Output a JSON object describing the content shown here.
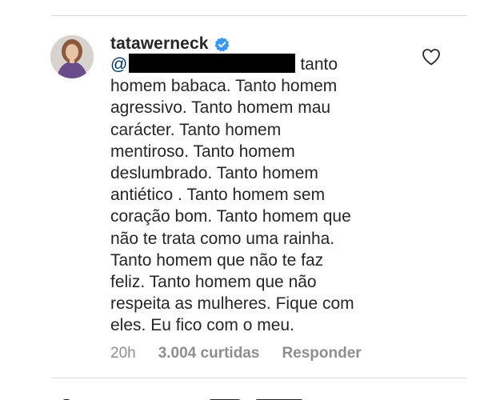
{
  "comment": {
    "username": "tatawerneck",
    "verified": true,
    "mention_prefix": "@",
    "lines": [
      "tanto",
      "homem babaca. Tanto homem",
      "agressivo. Tanto homem mau",
      "carácter. Tanto homem",
      "mentiroso. Tanto homem",
      "deslumbrado. Tanto homem",
      "antiético . Tanto homem sem",
      "coração bom. Tanto homem que",
      "não te trata como uma rainha.",
      "Tanto homem que não te faz",
      "feliz. Tanto homem que não",
      "respeita as mulheres. Fique com",
      "eles. Eu fico com o meu."
    ],
    "time": "20h",
    "likes": "3.004 curtidas",
    "reply_label": "Responder"
  },
  "colors": {
    "text": "#262626",
    "secondary": "#8e8e8e",
    "verified_badge": "#3897f0",
    "mention": "#00376b",
    "divider": "#dbdbdb"
  },
  "icons": {
    "verified": "verified-badge-icon",
    "like": "heart-outline-icon"
  }
}
